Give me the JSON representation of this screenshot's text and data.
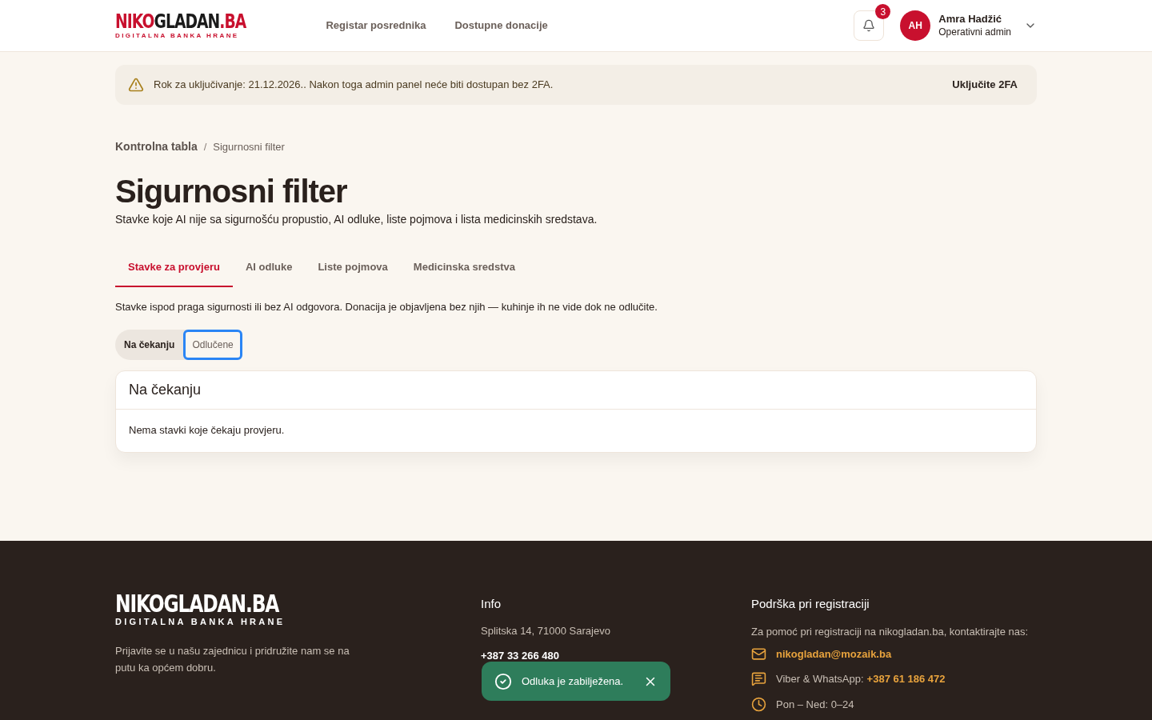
{
  "header": {
    "logo": {
      "parts": [
        {
          "text": "NIKO",
          "accent": true
        },
        {
          "text": "GLADAN",
          "accent": false
        },
        {
          "text": ".BA",
          "accent": true
        }
      ],
      "tagline": "DIGITALNA BANKA HRANE"
    },
    "nav": [
      "Registar posrednika",
      "Dostupne donacije"
    ],
    "notifications": {
      "count": "3"
    },
    "user": {
      "initials": "AH",
      "name": "Amra Hadžić",
      "role": "Operativni admin"
    }
  },
  "banner": {
    "text": "Rok za uključivanje: 21.12.2026.. Nakon toga admin panel neće biti dostupan bez 2FA.",
    "action": "Uključite 2FA"
  },
  "breadcrumb": {
    "items": [
      "Kontrolna tabla",
      "Sigurnosni filter"
    ],
    "separator": "/"
  },
  "title": "Sigurnosni filter",
  "subtitle": "Stavke koje AI nije sa sigurnošću propustio, AI odluke, liste pojmova i lista medicinskih sredstava.",
  "tabs": [
    {
      "label": "Stavke za provjeru",
      "selected": true
    },
    {
      "label": "AI odluke",
      "selected": false
    },
    {
      "label": "Liste pojmova",
      "selected": false
    },
    {
      "label": "Medicinska sredstva",
      "selected": false
    }
  ],
  "description": "Stavke ispod praga sigurnosti ili bez AI odgovora. Donacija je objavljena bez njih — kuhinje ih ne vide dok ne odlučite.",
  "segments": [
    {
      "label": "Na čekanju",
      "selected": true,
      "focused": false
    },
    {
      "label": "Odlučene",
      "selected": false,
      "focused": true
    }
  ],
  "panel": {
    "title": "Na čekanju",
    "empty": "Nema stavki koje čekaju provjeru."
  },
  "footer": {
    "logo": {
      "parts": [
        {
          "text": "NIKOGLADAN.BA",
          "accent": false
        }
      ],
      "tagline": "DIGITALNA BANKA HRANE"
    },
    "about": "Prijavite se u našu zajednicu i pridružite nam se na putu ka općem dobru.",
    "info": {
      "title": "Info",
      "address": "Splitska 14, 71000 Sarajevo",
      "phone": "+387 33 266 480"
    },
    "support": {
      "title": "Podrška pri registraciji",
      "text": "Za pomoć pri registraciji na nikogladan.ba, kontaktirajte nas:",
      "contacts": [
        {
          "kind": "email",
          "value": "nikogladan@mozaik.ba"
        },
        {
          "kind": "chat",
          "label": "Viber & WhatsApp:",
          "value": "+387 61 186 472"
        },
        {
          "kind": "hours",
          "label": "Pon – Ned: 0–24"
        }
      ]
    }
  },
  "toast": {
    "text": "Odluka je zabilježena."
  }
}
